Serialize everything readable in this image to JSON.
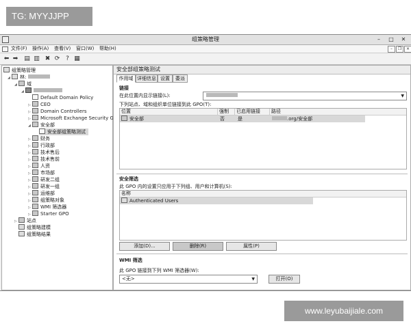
{
  "overlay": {
    "tag": "TG: MYYJJPP",
    "website": "www.leyubaijiale.com"
  },
  "window": {
    "title": "组策略管理",
    "menu": [
      "文件(F)",
      "操作(A)",
      "查看(V)",
      "窗口(W)",
      "帮助(H)"
    ]
  },
  "tree": {
    "root": "组策略管理",
    "forest": "林:",
    "domains": "域",
    "items": {
      "default_domain_policy": "Default Domain Policy",
      "ceo": "CEO",
      "domain_controllers": "Domain Controllers",
      "exchange": "Microsoft Exchange Security Gr",
      "security_dept": "安全部",
      "security_test": "安全部组策略测试",
      "finance": "财务",
      "admin": "行政部",
      "tech_after_sale": "技术售后",
      "tech_pre_sale": "技术售前",
      "hr": "人资",
      "marketing": "市场部",
      "rd2": "研发二组",
      "rd1": "研发一组",
      "ops": "运维部",
      "gpo_objects": "组策略对象",
      "wmi_filters": "WMI 筛选器",
      "starter_gpo": "Starter GPO",
      "sites": "站点",
      "modeling": "组策略建模",
      "results": "组策略结果"
    }
  },
  "details": {
    "title": "安全部组策略测试",
    "tabs": [
      "作用域",
      "详细信息",
      "设置",
      "委派"
    ],
    "links": {
      "heading": "链接",
      "location_label": "在此位置内显示链接(L):",
      "desc": "下列站点、域和组织单位链接到此 GPO(T):",
      "columns": [
        "位置",
        "强制",
        "已启用链接",
        "路径"
      ],
      "rows": [
        {
          "location": "安全部",
          "enforced": "否",
          "enabled": "是",
          "path": ".org/安全部"
        }
      ]
    },
    "security": {
      "heading": "安全筛选",
      "desc": "此 GPO 内的设置只应用于下列组、用户和计算机(S):",
      "column": "名称",
      "rows": [
        "Authenticated Users"
      ],
      "buttons": {
        "add": "添加(D)...",
        "remove": "删除(R)",
        "properties": "属性(P)"
      }
    },
    "wmi": {
      "heading": "WMI 筛选",
      "desc": "此 GPO 链接到下列 WMI 筛选器(W):",
      "value": "<无>",
      "open": "打开(O)"
    }
  }
}
